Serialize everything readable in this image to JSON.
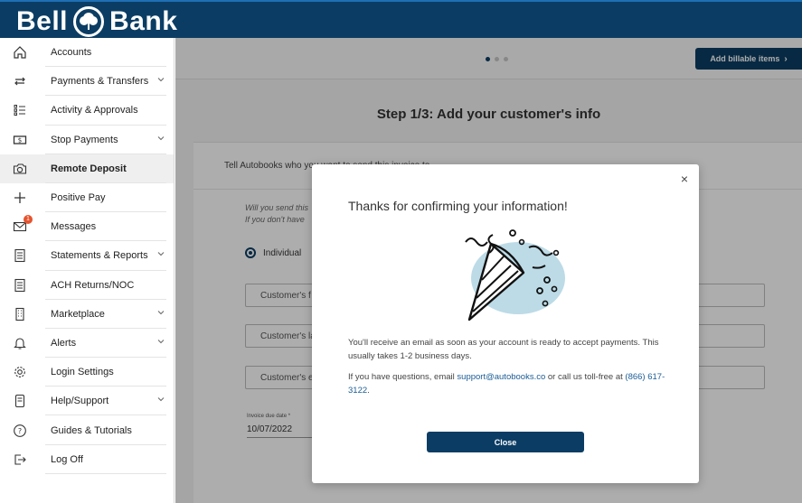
{
  "brand": {
    "part1": "Bell",
    "part2": "Bank"
  },
  "sidebar": {
    "items": [
      {
        "label": "Accounts"
      },
      {
        "label": "Payments & Transfers"
      },
      {
        "label": "Activity & Approvals"
      },
      {
        "label": "Stop Payments"
      },
      {
        "label": "Remote Deposit"
      },
      {
        "label": "Positive Pay"
      },
      {
        "label": "Messages",
        "badge": "1"
      },
      {
        "label": "Statements & Reports"
      },
      {
        "label": "ACH Returns/NOC"
      },
      {
        "label": "Marketplace"
      },
      {
        "label": "Alerts"
      },
      {
        "label": "Login Settings"
      },
      {
        "label": "Help/Support"
      },
      {
        "label": "Guides & Tutorials"
      },
      {
        "label": "Log Off"
      }
    ]
  },
  "main": {
    "billable_button": "Add billable items",
    "step_title": "Step 1/3: Add your customer's info",
    "card_header": "Tell Autobooks who you want to send this invoice to",
    "question_line1": "Will you send this",
    "question_line2": "If you don't have",
    "radio_individual": "Individual",
    "field_first": "Customer's f",
    "field_last": "Customer's la",
    "field_email": "Customer's e",
    "due_date_label": "Invoice due date *",
    "due_date_value": "10/07/2022"
  },
  "modal": {
    "close_icon": "×",
    "title": "Thanks for confirming your information!",
    "para1": "You'll receive an email as soon as your account is ready to accept payments. This usually takes 1-2 business days.",
    "para2_prefix": "If you have questions, email ",
    "email": "support@autobooks.co",
    "para2_mid": " or call us toll-free at ",
    "phone": "(866) 617-3122",
    "para2_suffix": ".",
    "close_label": "Close"
  },
  "colors": {
    "brand": "#0b3d64",
    "accent": "#1b5d96",
    "badge": "#e5532d",
    "illustration": "#bcdbe6"
  }
}
